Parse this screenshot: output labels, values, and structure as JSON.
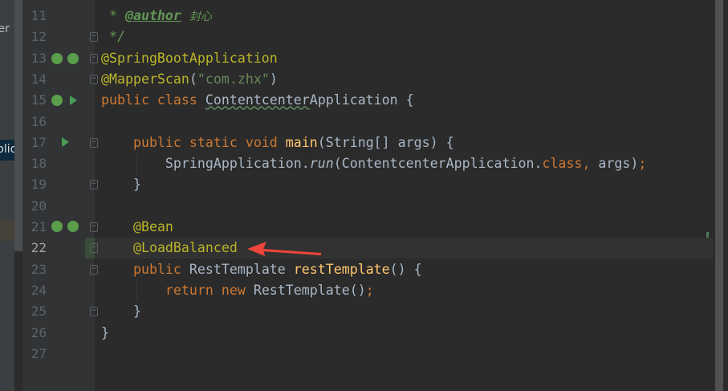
{
  "sidebar": {
    "fragments": [
      "ter",
      "t",
      "plica"
    ]
  },
  "editor": {
    "current_line": 22,
    "lines": [
      {
        "n": 11,
        "tokens": [
          {
            "t": " * ",
            "c": "c"
          },
          {
            "t": "@author",
            "c": "cu"
          },
          {
            "t": " ",
            "c": "c"
          },
          {
            "t": "封心",
            "c": "cn"
          }
        ]
      },
      {
        "n": 12,
        "tokens": [
          {
            "t": " */",
            "c": "c"
          }
        ]
      },
      {
        "n": 13,
        "tokens": [
          {
            "t": "@SpringBootApplication",
            "c": "a"
          }
        ]
      },
      {
        "n": 14,
        "tokens": [
          {
            "t": "@MapperScan",
            "c": "a"
          },
          {
            "t": "("
          },
          {
            "t": "\"com.zhx\"",
            "c": "s"
          },
          {
            "t": ")"
          }
        ]
      },
      {
        "n": 15,
        "tokens": [
          {
            "t": "public class ",
            "c": "k"
          },
          {
            "t": "Contentcenter",
            "c": "w"
          },
          {
            "t": "Application {"
          }
        ]
      },
      {
        "n": 16,
        "tokens": []
      },
      {
        "n": 17,
        "tokens": [
          {
            "t": "    public static void ",
            "c": "k"
          },
          {
            "t": "main",
            "c": "m"
          },
          {
            "t": "(String[] args) {"
          }
        ]
      },
      {
        "n": 18,
        "tokens": [
          {
            "t": "        SpringApplication."
          },
          {
            "t": "run",
            "c": "i"
          },
          {
            "t": "(ContentcenterApplication."
          },
          {
            "t": "class",
            "c": "k"
          },
          {
            "t": ", ",
            "c": "k"
          },
          {
            "t": "args)"
          },
          {
            "t": ";",
            "c": "k"
          }
        ]
      },
      {
        "n": 19,
        "tokens": [
          {
            "t": "    }"
          }
        ]
      },
      {
        "n": 20,
        "tokens": []
      },
      {
        "n": 21,
        "tokens": [
          {
            "t": "    "
          },
          {
            "t": "@Bean",
            "c": "a"
          }
        ]
      },
      {
        "n": 22,
        "tokens": [
          {
            "t": "    "
          },
          {
            "t": "@LoadBalanced",
            "c": "a"
          }
        ]
      },
      {
        "n": 23,
        "tokens": [
          {
            "t": "    public ",
            "c": "k"
          },
          {
            "t": "RestTemplate "
          },
          {
            "t": "restTemplate",
            "c": "m"
          },
          {
            "t": "() {"
          }
        ]
      },
      {
        "n": 24,
        "tokens": [
          {
            "t": "        return new ",
            "c": "k"
          },
          {
            "t": "RestTemplate()"
          },
          {
            "t": ";",
            "c": "k"
          }
        ]
      },
      {
        "n": 25,
        "tokens": [
          {
            "t": "    }"
          }
        ]
      },
      {
        "n": 26,
        "tokens": [
          {
            "t": "}"
          }
        ]
      },
      {
        "n": 27,
        "tokens": []
      }
    ]
  },
  "colors": {
    "arrow": "#f0453a",
    "background": "#2b2b2b",
    "keyword": "#cc7832",
    "annotation": "#bbb529"
  }
}
